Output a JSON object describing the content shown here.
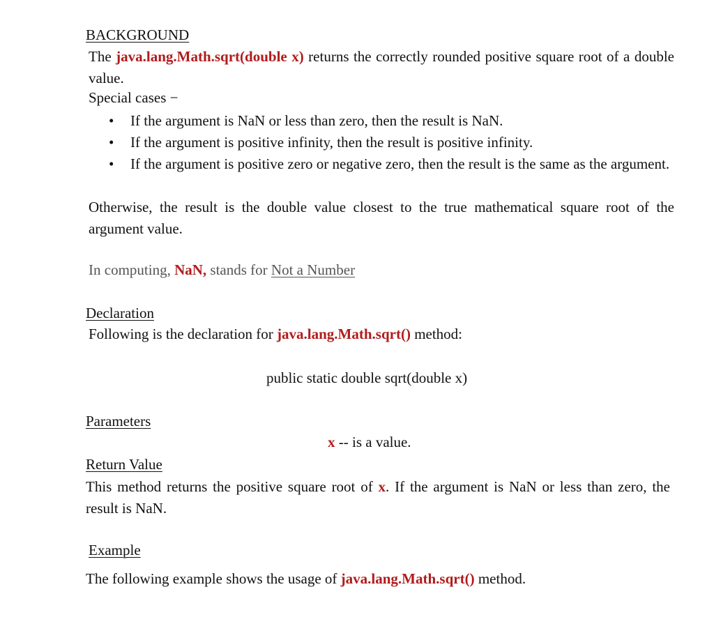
{
  "background": {
    "heading": "BACKGROUND",
    "intro_prefix": "The ",
    "intro_method": "java.lang.Math.sqrt(double x)",
    "intro_suffix": " returns the correctly rounded positive square root of a double value.",
    "special_cases_label": "Special cases −",
    "cases": [
      "If the argument is NaN or less than zero, then the result is NaN.",
      "If the argument is positive infinity, then the result is positive infinity.",
      "If the argument is positive zero or negative zero, then the result is the same as the argument."
    ],
    "otherwise": "Otherwise, the result is the double value closest to the true mathematical square root of the argument value.",
    "nan_prefix": "In computing, ",
    "nan_term": "NaN,",
    "nan_middle": " stands for ",
    "nan_expansion": "Not a Number"
  },
  "declaration": {
    "heading": "Declaration",
    "text_prefix": "Following is the declaration for ",
    "text_method": "java.lang.Math.sqrt()",
    "text_suffix": " method:",
    "signature": "public static double sqrt(double x)"
  },
  "parameters": {
    "heading": "Parameters",
    "param_name": "x",
    "param_desc": " --  is a value."
  },
  "return_value": {
    "heading": "Return Value",
    "text_prefix": "This method returns the positive square root of ",
    "text_var": "x",
    "text_suffix": ". If the argument is NaN or less than zero, the result is NaN."
  },
  "example": {
    "heading": "Example",
    "text_prefix": "The following example shows the usage of ",
    "text_method": "java.lang.Math.sqrt()",
    "text_suffix": " method."
  }
}
